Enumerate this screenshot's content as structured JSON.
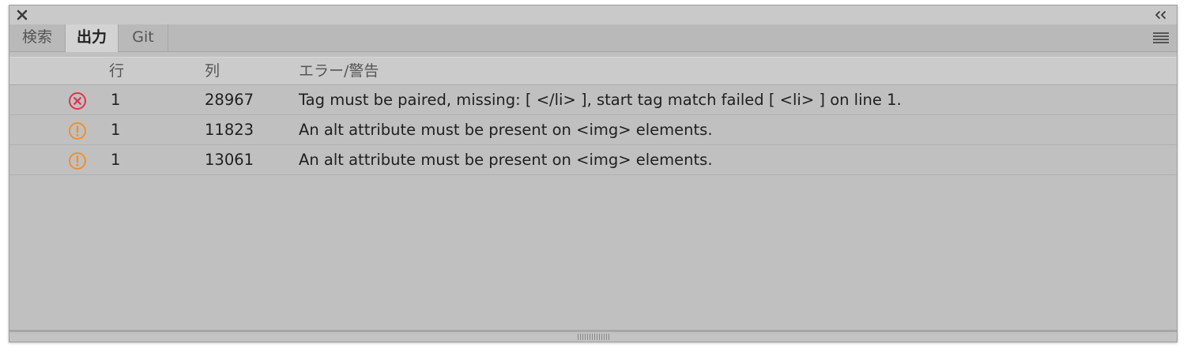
{
  "panel": {
    "tabs": [
      {
        "label": "検索",
        "active": false
      },
      {
        "label": "出力",
        "active": true
      },
      {
        "label": "Git",
        "active": false
      }
    ],
    "icons": {
      "close": "close-icon",
      "collapse": "double-chevron-left-icon",
      "menu": "hamburger-menu-icon"
    }
  },
  "table": {
    "headers": {
      "line": "行",
      "column": "列",
      "message": "エラー/警告"
    },
    "rows": [
      {
        "type": "error",
        "line": "1",
        "column": "28967",
        "message": "Tag must be paired, missing: [ </li> ], start tag match failed [ <li> ] on line 1."
      },
      {
        "type": "warning",
        "line": "1",
        "column": "11823",
        "message": "An alt attribute must be present on <img> elements."
      },
      {
        "type": "warning",
        "line": "1",
        "column": "13061",
        "message": "An alt attribute must be present on <img> elements."
      }
    ]
  },
  "colors": {
    "error": "#e0334a",
    "warning": "#f0902a"
  }
}
